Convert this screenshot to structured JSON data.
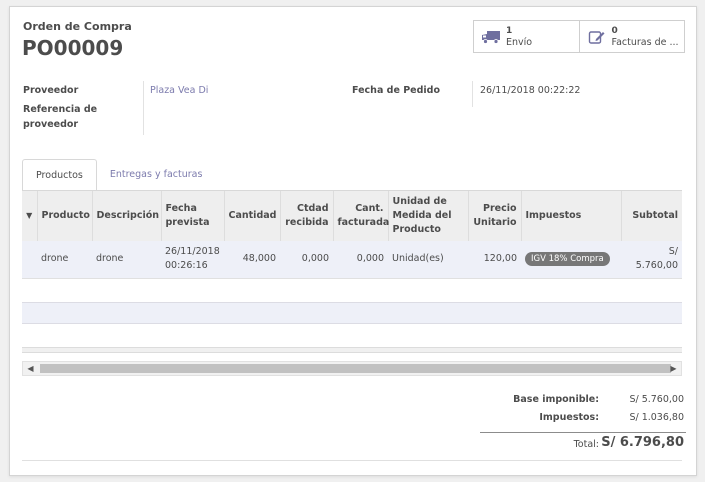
{
  "header": {
    "doc_label": "Orden de Compra",
    "doc_name": "PO00009"
  },
  "smart_buttons": [
    {
      "count": "1",
      "label": "Envío",
      "icon": "truck-icon"
    },
    {
      "count": "0",
      "label": "Facturas de ...",
      "icon": "pencil-square-icon"
    }
  ],
  "fields": {
    "vendor_label": "Proveedor",
    "vendor_value": "Plaza Vea Di",
    "vendor_ref_label_1": "Referencia de",
    "vendor_ref_label_2": "proveedor",
    "order_date_label": "Fecha de Pedido",
    "order_date_value": "26/11/2018 00:22:22"
  },
  "tabs": [
    {
      "label": "Productos",
      "active": true
    },
    {
      "label": "Entregas y facturas",
      "active": false
    }
  ],
  "table": {
    "columns": [
      {
        "lines": [
          "Producto"
        ]
      },
      {
        "lines": [
          "Descripción"
        ]
      },
      {
        "lines": [
          "Fecha",
          "prevista"
        ]
      },
      {
        "lines": [
          "Cantidad"
        ]
      },
      {
        "lines": [
          "Ctdad",
          "recibida"
        ]
      },
      {
        "lines": [
          "Cant.",
          "facturada"
        ]
      },
      {
        "lines": [
          "Unidad de",
          "Medida del",
          "Producto"
        ]
      },
      {
        "lines": [
          "Precio",
          "Unitario"
        ]
      },
      {
        "lines": [
          "Impuestos"
        ]
      },
      {
        "lines": [
          "Subtotal"
        ]
      }
    ],
    "rows": [
      {
        "product": "drone",
        "description": "drone",
        "date_1": "26/11/2018",
        "date_2": "00:26:16",
        "qty": "48,000",
        "received": "0,000",
        "invoiced": "0,000",
        "uom": "Unidad(es)",
        "price": "120,00",
        "tax": "IGV 18% Compra",
        "subtotal": "S/ 5.760,00"
      }
    ]
  },
  "totals": {
    "base_label": "Base imponible:",
    "base_value": "S/ 5.760,00",
    "tax_label": "Impuestos:",
    "tax_value": "S/ 1.036,80",
    "total_label": "Total:",
    "total_value": "S/ 6.796,80"
  },
  "colors": {
    "link": "#7c7bad",
    "badge": "#777777",
    "row_highlight": "#eef0f8"
  }
}
